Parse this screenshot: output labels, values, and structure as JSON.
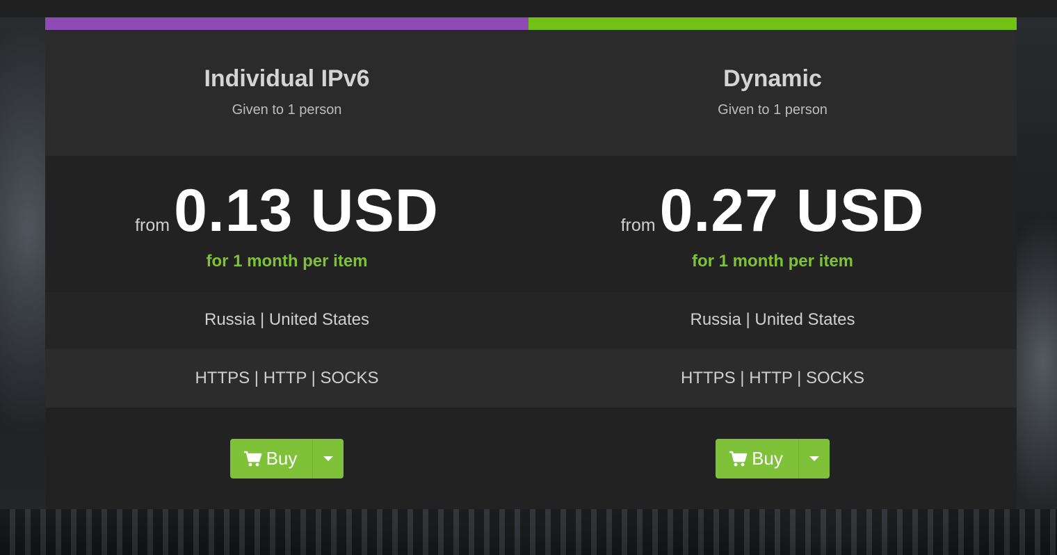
{
  "plans": [
    {
      "accent_color": "#8e4bb3",
      "title": "Individual IPv6",
      "subtitle": "Given to 1 person",
      "price_prefix": "from",
      "price": "0.13 USD",
      "period": "for 1 month per item",
      "countries": "Russia | United States",
      "protocols": "HTTPS | HTTP | SOCKS",
      "buy_label": "Buy",
      "cart_icon": "shopping-cart-icon",
      "toggle_icon": "caret-down-icon"
    },
    {
      "accent_color": "#74c116",
      "title": "Dynamic",
      "subtitle": "Given to 1 person",
      "price_prefix": "from",
      "price": "0.27 USD",
      "period": "for 1 month per item",
      "countries": "Russia | United States",
      "protocols": "HTTPS | HTTP | SOCKS",
      "buy_label": "Buy",
      "cart_icon": "shopping-cart-icon",
      "toggle_icon": "caret-down-icon"
    }
  ],
  "button_color": "#7fc23a",
  "period_color": "#7fc23a"
}
